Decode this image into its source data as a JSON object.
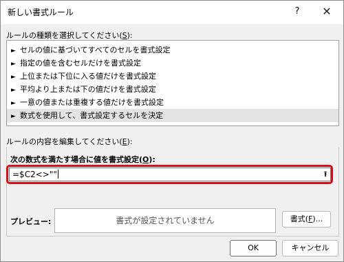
{
  "window": {
    "title": "新しい書式ルール",
    "help_glyph": "?",
    "close_glyph": "✕"
  },
  "rule_type": {
    "label": "ルールの種類を選択してください(",
    "accel": "S",
    "label_end": "):",
    "items": [
      {
        "label": "セルの値に基づいてすべてのセルを書式設定",
        "selected": false
      },
      {
        "label": "指定の値を含むセルだけを書式設定",
        "selected": false
      },
      {
        "label": "上位または下位に入る値だけを書式設定",
        "selected": false
      },
      {
        "label": "平均より上または下の値だけを書式設定",
        "selected": false
      },
      {
        "label": "一意の値または重複する値だけを書式設定",
        "selected": false
      },
      {
        "label": "数式を使用して、書式設定するセルを決定",
        "selected": true
      }
    ]
  },
  "rule_edit": {
    "label": "ルールの内容を編集してください(",
    "accel": "E",
    "label_end": "):"
  },
  "formula": {
    "label": "次の数式を満たす場合に値を書式設定(",
    "accel": "O",
    "label_end": "):",
    "value": "=$C2<>\"\""
  },
  "preview": {
    "label": "プレビュー:",
    "text": "書式が設定されていません"
  },
  "buttons": {
    "format_label": "書式(",
    "format_accel": "F",
    "format_end": ")...",
    "ok": "OK",
    "cancel": "キャンセル"
  }
}
